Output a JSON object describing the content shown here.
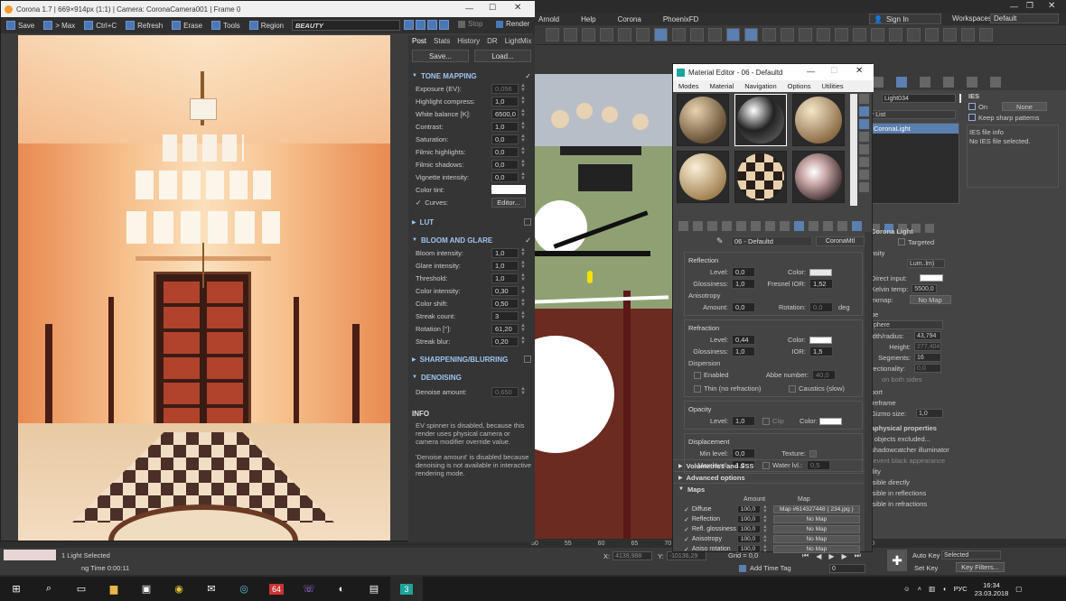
{
  "vfb": {
    "title": "Corona 1.7 | 669×914px (1:1) | Camera: CoronaCamera001 | Frame 0",
    "toolbar": [
      "Save",
      "> Max",
      "Ctrl+C",
      "Refresh",
      "Erase",
      "Tools",
      "Region"
    ],
    "channel": "BEAUTY",
    "stop_label": "Stop",
    "render_label": "Render",
    "tabs": [
      "Post",
      "Stats",
      "History",
      "DR",
      "LightMix"
    ],
    "save_btn": "Save...",
    "load_btn": "Load...",
    "tone_mapping": {
      "title": "TONE MAPPING",
      "rows": [
        {
          "label": "Exposure (EV):",
          "value": "0,056"
        },
        {
          "label": "Highlight compress:",
          "value": "1,0"
        },
        {
          "label": "White balance [K]:",
          "value": "6500,0"
        },
        {
          "label": "Contrast:",
          "value": "1,0"
        },
        {
          "label": "Saturation:",
          "value": "0,0"
        },
        {
          "label": "Filmic highlights:",
          "value": "0,0"
        },
        {
          "label": "Filmic shadows:",
          "value": "0,0"
        },
        {
          "label": "Vignette intensity:",
          "value": "0,0"
        }
      ],
      "color_tint": "Color tint:",
      "curves": "Curves:",
      "editor": "Editor..."
    },
    "lut": "LUT",
    "bloom": {
      "title": "BLOOM AND GLARE",
      "rows": [
        {
          "label": "Bloom intensity:",
          "value": "1,0"
        },
        {
          "label": "Glare intensity:",
          "value": "1,0"
        },
        {
          "label": "Threshold:",
          "value": "1,0"
        },
        {
          "label": "Color intensity:",
          "value": "0,30"
        },
        {
          "label": "Color shift:",
          "value": "0,50"
        },
        {
          "label": "Streak count:",
          "value": "3"
        },
        {
          "label": "Rotation [°]:",
          "value": "61,20"
        },
        {
          "label": "Streak blur:",
          "value": "0,20"
        }
      ]
    },
    "sharpening": "SHARPENING/BLURRING",
    "denoising": "DENOISING",
    "denoise_label": "Denoise amount:",
    "denoise_value": "0,650",
    "info_title": "INFO",
    "info_1": "EV spinner is disabled, because this render uses physical camera or camera modifier override value.",
    "info_2": "'Denoise amount' is disabled because denoising is not available in interactive rendering mode."
  },
  "max": {
    "menus": [
      "Arnold",
      "Help",
      "Corona",
      "PhoenixFD"
    ],
    "sign_in": "Sign In",
    "workspaces_label": "Workspaces:",
    "workspaces_value": "Default"
  },
  "mated": {
    "title": "Material Editor - 06 - Defaultd",
    "menus": [
      "Modes",
      "Material",
      "Navigation",
      "Options",
      "Utilities"
    ],
    "material_name": "06 - Defaultd",
    "material_type": "CoronaMtl",
    "reflection": {
      "title": "Reflection",
      "level_label": "Level:",
      "level": "0,0",
      "color_label": "Color:",
      "gloss_label": "Glossiness:",
      "gloss": "1,0",
      "fresnel_label": "Fresnel IOR:",
      "fresnel": "1,52",
      "aniso_title": "Anisotropy",
      "amount_label": "Amount:",
      "amount": "0,0",
      "rotation_label": "Rotation:",
      "rotation": "0,0",
      "deg": "deg"
    },
    "refraction": {
      "title": "Refraction",
      "level_label": "Level:",
      "level": "0,44",
      "color_label": "Color:",
      "gloss_label": "Glossiness:",
      "gloss": "1,0",
      "ior_label": "IOR:",
      "ior": "1,5",
      "dispersion": "Dispersion",
      "enabled": "Enabled",
      "abbe_label": "Abbe number:",
      "abbe": "40,0",
      "thin": "Thin (no refraction)",
      "caustics": "Caustics (slow)"
    },
    "opacity": {
      "title": "Opacity",
      "level_label": "Level:",
      "level": "1,0",
      "clip": "Clip",
      "color_label": "Color:"
    },
    "displacement": {
      "title": "Displacement",
      "min_label": "Min level:",
      "min": "0,0",
      "texture_label": "Texture:",
      "max_label": "Max level:",
      "max": "1,0",
      "water_label": "Water lvl.:",
      "water": "0,5"
    },
    "rollouts": [
      "Volumetrics and SSS",
      "Advanced options",
      "Maps"
    ],
    "maps_amount": "Amount",
    "maps_map": "Map",
    "maps": [
      {
        "label": "Diffuse",
        "amount": "100,0",
        "map": "Map #6143274​48 ( 234.jpg )"
      },
      {
        "label": "Reflection",
        "amount": "100,0",
        "map": "No Map"
      },
      {
        "label": "Refl. glossiness",
        "amount": "100,0",
        "map": "No Map"
      },
      {
        "label": "Anisotropy",
        "amount": "100,0",
        "map": "No Map"
      },
      {
        "label": "Aniso rotation",
        "amount": "100,0",
        "map": "No Map"
      }
    ]
  },
  "cmd": {
    "object_name": "Light034",
    "modifier_list": "r List",
    "stack_item": "CoronaLight",
    "ies_title": "IES",
    "ies_on": "On",
    "ies_none": "None",
    "keep_sharp": "Keep sharp patterns",
    "ies_info_title": "IES file info",
    "ies_info_text": "No IES file selected.",
    "corona_light": "Corona Light",
    "targeted": "Targeted",
    "intensity_label": "nsity",
    "intensity_unit": "Lum..lm)",
    "direct_input": "Direct input:",
    "kelvin_label": "Kelvin temp:",
    "kelvin": "5500,0",
    "texmap_label": "exmap:",
    "no_map": "No Map",
    "shape_label": "pe",
    "shape_value": "phere",
    "width_label": "idth/radius:",
    "width": "43,794",
    "height_label": "Height:",
    "height": "277,404",
    "segments_label": "Segments:",
    "segments": "16",
    "directionality_label": "rectionality:",
    "directionality": "0,0",
    "both_sides": "on both sides",
    "viewport_label": "port",
    "wireframe": "ireframe",
    "gizmo_label": "Gizmo size:",
    "gizmo": "1,0",
    "physical_title": "aphysical properties",
    "objects_excluded": "l objects excluded...",
    "shadowcatcher": "shadowcatcher illuminator",
    "prevent_black": "revent black appearance",
    "visibility": "ility",
    "vis_direct": "isible directly",
    "vis_refl": "isible in reflections",
    "vis_refr": "isible in refractions"
  },
  "status": {
    "selected": "1 Light Selected",
    "render_time": "ng Time  0:00:11",
    "x_label": "X:",
    "x_value": "4139,988",
    "y_label": "Y:",
    "y_value": "-10136,29",
    "grid_label": "Grid = 0,0",
    "add_time_tag": "Add Time Tag",
    "auto_key": "Auto Key",
    "selected_dd": "Selected",
    "set_key": "Set Key",
    "key_filters": "Key Filters...",
    "frame": "0",
    "ruler": [
      "50",
      "55",
      "60",
      "65",
      "70",
      "75",
      "80",
      "85",
      "90",
      "95",
      "100"
    ]
  },
  "taskbar": {
    "time": "16:34",
    "date": "23.03.2018",
    "lang": "РУС",
    "item_64": "64",
    "max_item": "3"
  }
}
